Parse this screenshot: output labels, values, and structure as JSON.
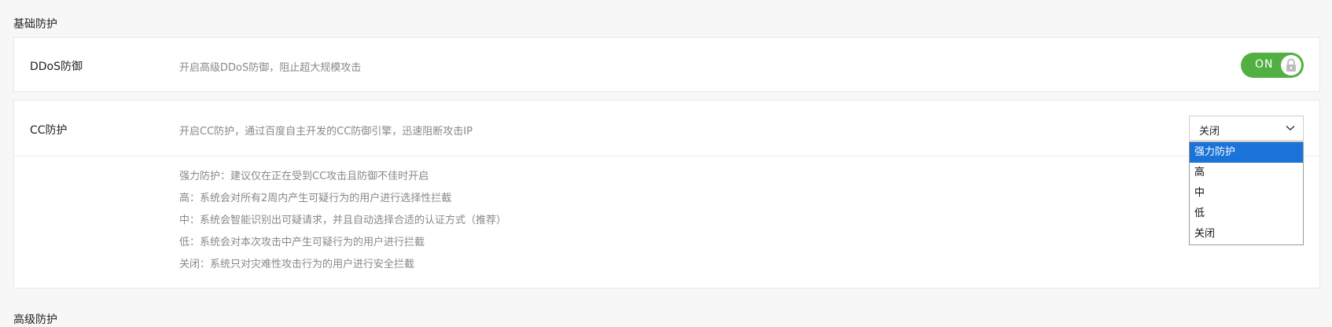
{
  "sections": {
    "basic_title": "基础防护",
    "advanced_title": "高级防护"
  },
  "ddos": {
    "label": "DDoS防御",
    "description": "开启高级DDoS防御，阻止超大规模攻击",
    "toggle_text": "ON",
    "toggle_state": "on",
    "toggle_locked": true,
    "toggle_color": "#52b043"
  },
  "cc": {
    "label": "CC防护",
    "description": "开启CC防护，通过百度自主开发的CC防御引擎，迅速阻断攻击IP",
    "select_value": "关闭",
    "dropdown_open": true,
    "highlighted_option": "强力防护",
    "highlight_color": "#1a73d9",
    "options": [
      "强力防护",
      "高",
      "中",
      "低",
      "关闭"
    ],
    "help": [
      "强力防护：建议仅在正在受到CC攻击且防御不佳时开启",
      "高：系统会对所有2周内产生可疑行为的用户进行选择性拦截",
      "中：系统会智能识别出可疑请求，并且自动选择合适的认证方式（推荐）",
      "低：系统会对本次攻击中产生可疑行为的用户进行拦截",
      "关闭：系统只对灾难性攻击行为的用户进行安全拦截"
    ]
  },
  "icons": {
    "toggle_lock": "lock-icon",
    "select_arrow": "chevron-down-icon"
  }
}
